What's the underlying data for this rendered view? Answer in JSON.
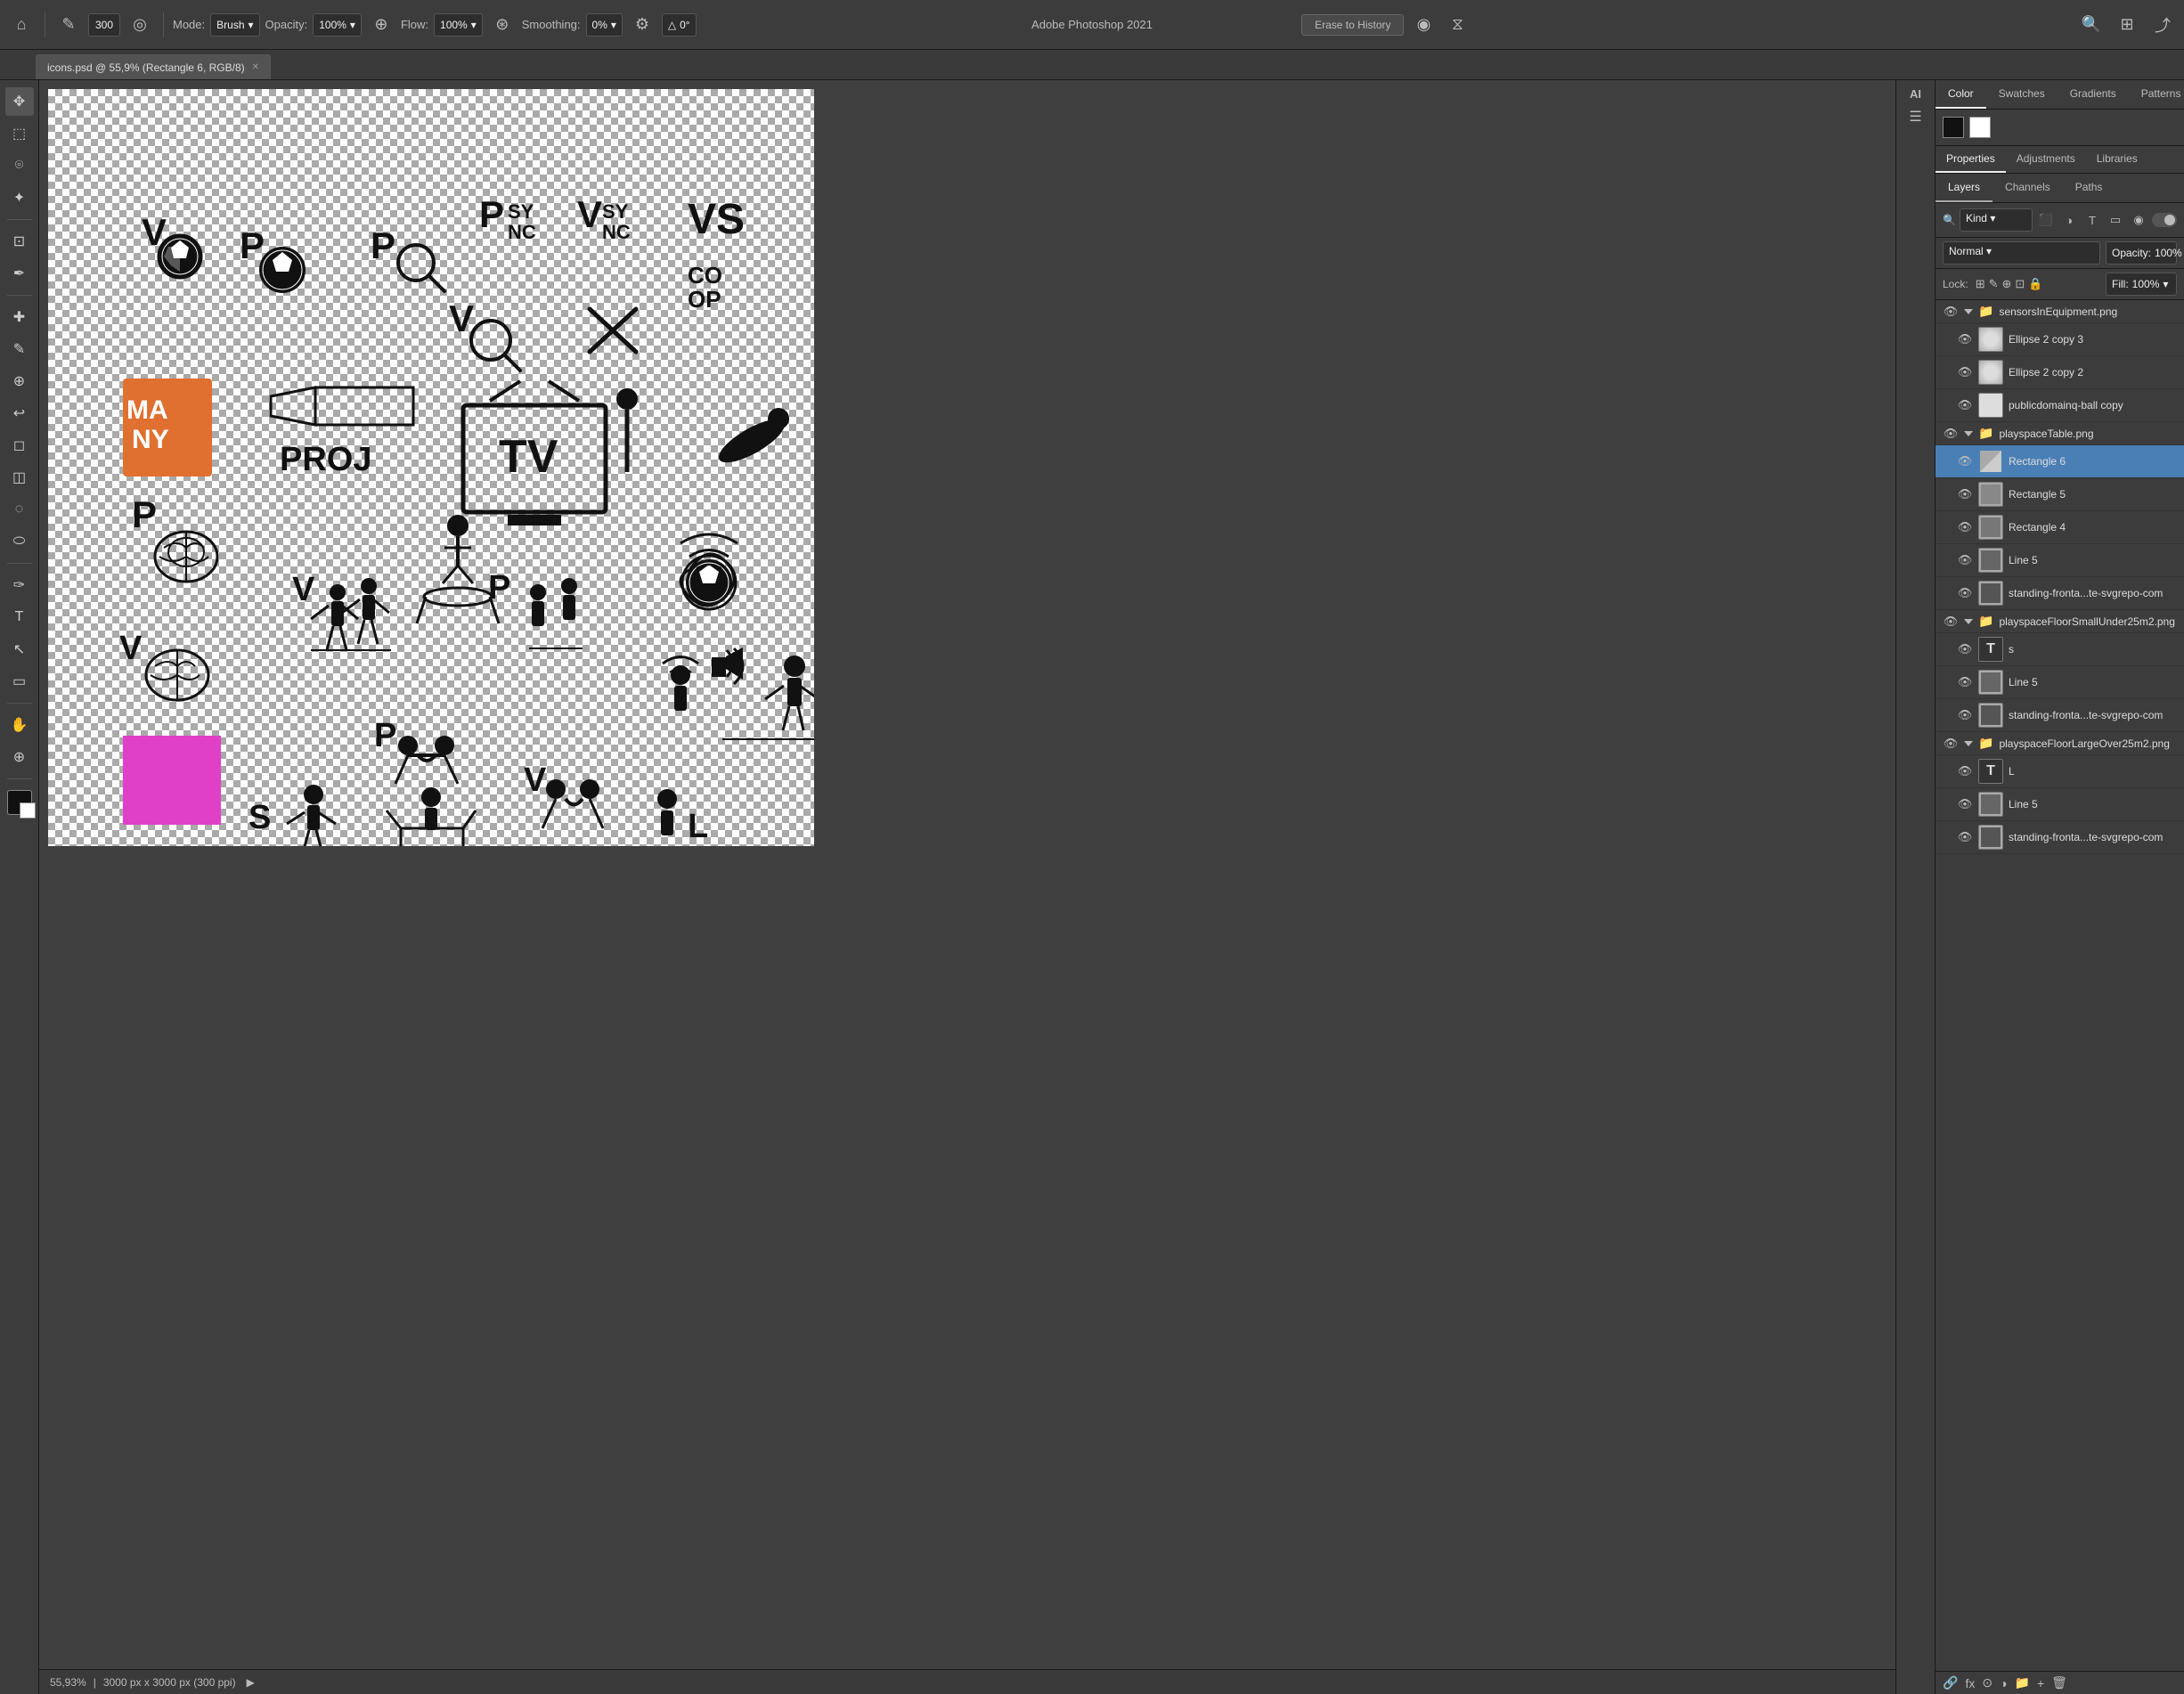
{
  "app": {
    "title": "Adobe Photoshop 2021",
    "tab_label": "icons.psd @ 55,9% (Rectangle 6, RGB/8)"
  },
  "toolbar": {
    "brush_size": "300",
    "mode_label": "Mode:",
    "mode_value": "Brush",
    "opacity_label": "Opacity:",
    "opacity_value": "100%",
    "flow_label": "Flow:",
    "flow_value": "100%",
    "smoothing_label": "Smoothing:",
    "smoothing_value": "0%",
    "angle_value": "0°",
    "erase_to_history": "Erase to History"
  },
  "top_panel": {
    "color_tab": "Color",
    "swatches_tab": "Swatches",
    "gradients_tab": "Gradients",
    "patterns_tab": "Patterns"
  },
  "properties_panel": {
    "properties_tab": "Properties",
    "adjustments_tab": "Adjustments",
    "libraries_tab": "Libraries"
  },
  "layers_panel": {
    "layers_tab": "Layers",
    "channels_tab": "Channels",
    "paths_tab": "Paths",
    "kind_label": "Kind",
    "blend_mode": "Normal",
    "opacity_label": "Opacity:",
    "opacity_value": "100%",
    "lock_label": "Lock:",
    "fill_label": "Fill:",
    "fill_value": "100%",
    "layers": [
      {
        "id": "sensors-group",
        "type": "group",
        "name": "sensorsInEquipment.png",
        "visible": true,
        "indent": 0
      },
      {
        "id": "ellipse2copy3",
        "type": "layer",
        "name": "Ellipse 2 copy 3",
        "visible": true,
        "indent": 1
      },
      {
        "id": "ellipse2copy2",
        "type": "layer",
        "name": "Ellipse 2 copy 2",
        "visible": true,
        "indent": 1
      },
      {
        "id": "publicdomain-ball",
        "type": "layer",
        "name": "publicdomainq-ball copy",
        "visible": true,
        "indent": 1
      },
      {
        "id": "playspace-table-group",
        "type": "group",
        "name": "playspaceTable.png",
        "visible": true,
        "indent": 0
      },
      {
        "id": "rectangle6",
        "type": "layer",
        "name": "Rectangle 6",
        "visible": true,
        "indent": 1,
        "active": true
      },
      {
        "id": "rectangle5",
        "type": "layer",
        "name": "Rectangle 5",
        "visible": true,
        "indent": 1
      },
      {
        "id": "rectangle4",
        "type": "layer",
        "name": "Rectangle 4",
        "visible": true,
        "indent": 1
      },
      {
        "id": "line5-1",
        "type": "layer",
        "name": "Line 5",
        "visible": true,
        "indent": 1
      },
      {
        "id": "standing-fronta1",
        "type": "layer",
        "name": "standing-fronta...te-svgrepo-com",
        "visible": true,
        "indent": 1
      },
      {
        "id": "playspace-floor-small-group",
        "type": "group",
        "name": "playspaceFloorSmallUnder25m2.png",
        "visible": true,
        "indent": 0
      },
      {
        "id": "text-s",
        "type": "text",
        "name": "s",
        "visible": true,
        "indent": 1
      },
      {
        "id": "line5-2",
        "type": "layer",
        "name": "Line 5",
        "visible": true,
        "indent": 1
      },
      {
        "id": "standing-fronta2",
        "type": "layer",
        "name": "standing-fronta...te-svgrepo-com",
        "visible": true,
        "indent": 1
      },
      {
        "id": "playspace-floor-large-group",
        "type": "group",
        "name": "playspaceFloorLargeOver25m2.png",
        "visible": true,
        "indent": 0
      },
      {
        "id": "text-l",
        "type": "text",
        "name": "L",
        "visible": true,
        "indent": 1
      },
      {
        "id": "line5-3",
        "type": "layer",
        "name": "Line 5",
        "visible": true,
        "indent": 1
      },
      {
        "id": "standing-fronta3",
        "type": "layer",
        "name": "standing-fronta...te-svgrepo-com",
        "visible": true,
        "indent": 1
      }
    ]
  },
  "statusbar": {
    "zoom": "55,93%",
    "dimensions": "3000 px x 3000 px (300 ppi)"
  }
}
